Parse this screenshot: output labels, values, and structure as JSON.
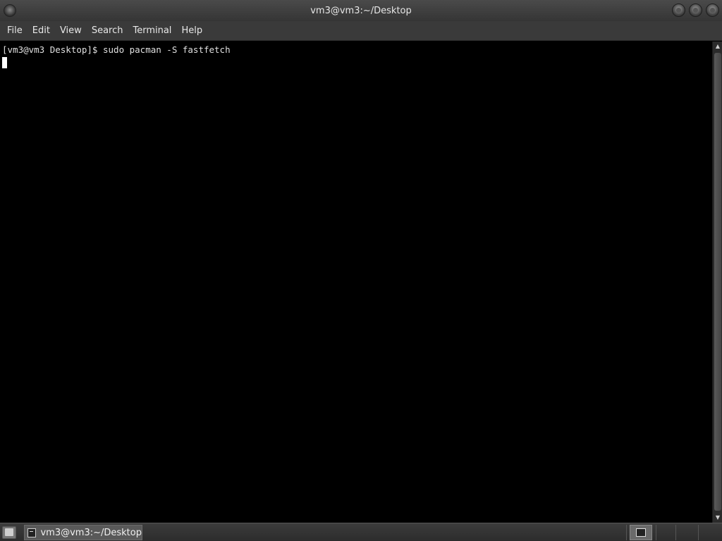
{
  "window": {
    "title": "vm3@vm3:~/Desktop"
  },
  "menubar": {
    "items": [
      "File",
      "Edit",
      "View",
      "Search",
      "Terminal",
      "Help"
    ]
  },
  "terminal": {
    "lines": [
      "[vm3@vm3 Desktop]$ sudo pacman -S fastfetch"
    ]
  },
  "taskbar": {
    "task_label": "vm3@vm3:~/Desktop"
  }
}
